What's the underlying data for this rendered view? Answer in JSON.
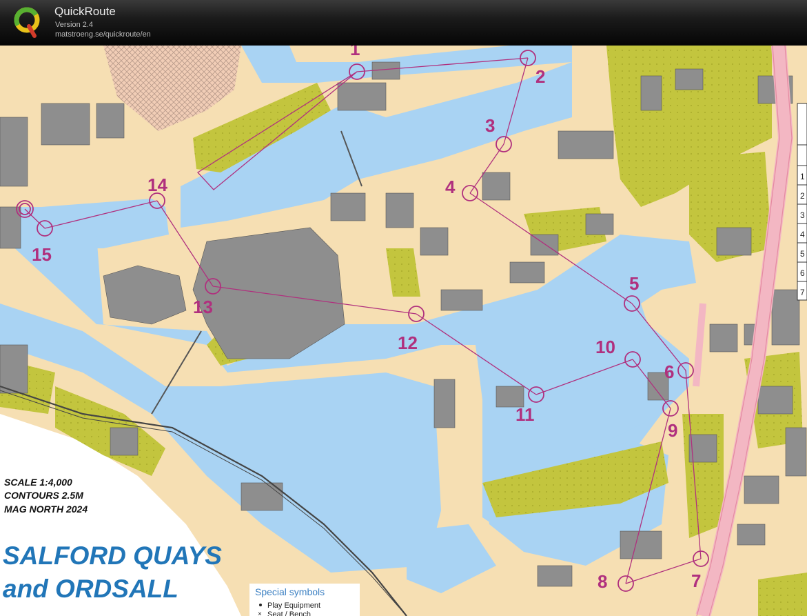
{
  "app": {
    "title": "QuickRoute",
    "version": "Version 2.4",
    "url": "matstroeng.se/quickroute/en"
  },
  "map": {
    "scale": "SCALE 1:4,000",
    "contours": "CONTOURS 2.5M",
    "mag_north": "MAG NORTH 2024",
    "title_line1": "SALFORD QUAYS",
    "title_line2": "and ORDSALL",
    "legend": {
      "heading": "Special symbols",
      "items": [
        "Play Equipment",
        "Seat / Bench"
      ]
    },
    "side_numbers": [
      "1",
      "2",
      "3",
      "4",
      "5",
      "6",
      "7"
    ],
    "controls": [
      {
        "label": "1"
      },
      {
        "label": "2"
      },
      {
        "label": "3"
      },
      {
        "label": "4"
      },
      {
        "label": "5"
      },
      {
        "label": "6"
      },
      {
        "label": "7"
      },
      {
        "label": "8"
      },
      {
        "label": "9"
      },
      {
        "label": "10"
      },
      {
        "label": "11"
      },
      {
        "label": "12"
      },
      {
        "label": "13"
      },
      {
        "label": "14"
      },
      {
        "label": "15"
      }
    ],
    "colors": {
      "water": "#a9d3f3",
      "built_area": "#f6dfb3",
      "building": "#8e8e8e",
      "vegetation": "#c3c53e",
      "course": "#b0307e",
      "road_pink": "#f3b7c3",
      "title_blue": "#2176b8"
    }
  }
}
